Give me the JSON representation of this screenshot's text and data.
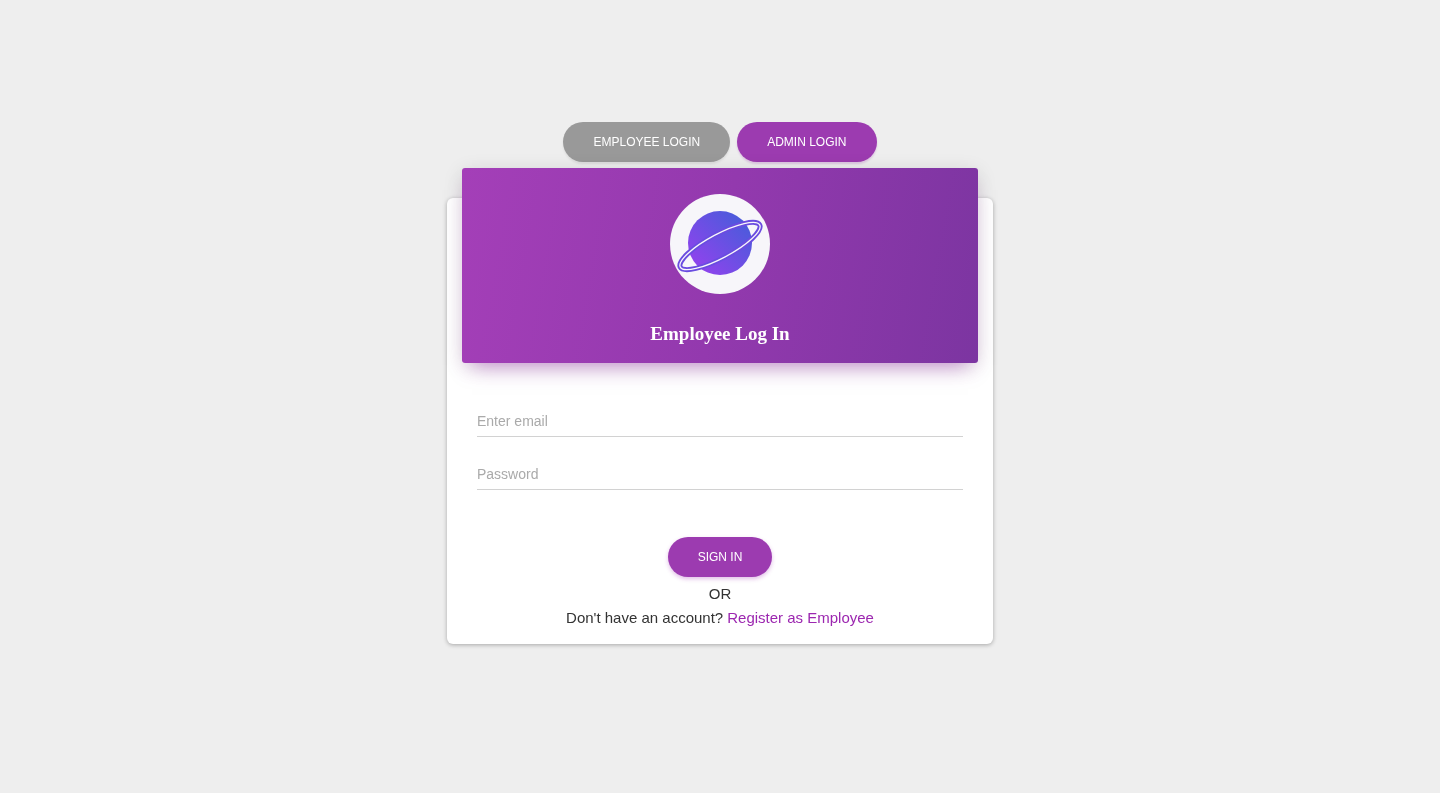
{
  "login_tabs": [
    {
      "label": "EMPLOYEE LOGIN",
      "selected": true
    },
    {
      "label": "ADMIN LOGIN",
      "selected": false
    }
  ],
  "card": {
    "title": "Employee Log In",
    "fields": [
      {
        "placeholder": "Enter email"
      },
      {
        "placeholder": "Password"
      }
    ],
    "submit_button": "SIGN IN",
    "separator": "OR",
    "register_prompt": "Don't have an account?",
    "register_link": "Register as Employee"
  }
}
